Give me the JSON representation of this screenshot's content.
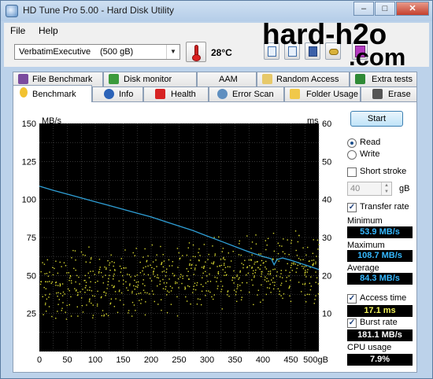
{
  "window": {
    "title": "HD Tune Pro 5.00 - Hard Disk Utility"
  },
  "menu": {
    "file": "File",
    "help": "Help"
  },
  "toolbar": {
    "drive_name": "VerbatimExecutive",
    "drive_size": "(500 gB)",
    "temperature": "28°C"
  },
  "brand": {
    "line1": "hard-h2o",
    "line2": ".com"
  },
  "tabs_row1": [
    "File Benchmark",
    "Disk monitor",
    "AAM",
    "Random Access",
    "Extra tests"
  ],
  "tabs_row2": [
    "Benchmark",
    "Info",
    "Health",
    "Error Scan",
    "Folder Usage",
    "Erase"
  ],
  "active_tab": "Benchmark",
  "controls": {
    "start_label": "Start",
    "read_label": "Read",
    "write_label": "Write",
    "mode_selected": "Read",
    "short_stroke_label": "Short stroke",
    "short_stroke_checked": false,
    "short_stroke_value": "40",
    "short_stroke_unit": "gB",
    "transfer_rate_label": "Transfer rate",
    "transfer_rate_checked": true,
    "minimum_label": "Minimum",
    "minimum_value": "53.9 MB/s",
    "maximum_label": "Maximum",
    "maximum_value": "108.7 MB/s",
    "average_label": "Average",
    "average_value": "84.3 MB/s",
    "access_time_label": "Access time",
    "access_time_checked": true,
    "access_time_value": "17.1 ms",
    "burst_rate_label": "Burst rate",
    "burst_rate_checked": true,
    "burst_rate_value": "181.1 MB/s",
    "cpu_usage_label": "CPU usage",
    "cpu_usage_value": "7.9%"
  },
  "colors": {
    "chart_bg": "#000000",
    "grid": "#555555",
    "transfer_line": "#2f9fd6",
    "access_dots": "#d8d830",
    "close_button": "#c4402e"
  },
  "chart_data": {
    "type": "line",
    "xlabel": "",
    "x_tick_labels": [
      "0",
      "50",
      "100",
      "150",
      "200",
      "250",
      "300",
      "350",
      "400",
      "450",
      "500gB"
    ],
    "y_left_unit": "MB/s",
    "y_left_ticks": [
      "150",
      "125",
      "100",
      "75",
      "50",
      "25"
    ],
    "y_right_unit": "ms",
    "y_right_ticks": [
      "60",
      "50",
      "40",
      "30",
      "20",
      "10"
    ],
    "xlim": [
      0,
      500
    ],
    "ylim_left": [
      0,
      150
    ],
    "ylim_right": [
      0,
      60
    ],
    "grid": true,
    "series": [
      {
        "name": "Transfer rate",
        "axis": "left",
        "x": [
          0,
          25,
          50,
          75,
          100,
          125,
          150,
          175,
          200,
          225,
          250,
          275,
          300,
          325,
          350,
          375,
          400,
          415,
          420,
          425,
          435,
          450,
          475,
          500
        ],
        "y": [
          108.7,
          106,
          103.5,
          101,
          98.5,
          96,
          93.5,
          91,
          88.5,
          85.5,
          82.5,
          79.5,
          76,
          72.5,
          69,
          65.5,
          62.5,
          61,
          57,
          60.5,
          61.5,
          60,
          57,
          53.9
        ]
      },
      {
        "name": "Access time",
        "axis": "right",
        "type": "scatter",
        "x_range": [
          0,
          500
        ],
        "y_spread": [
          6,
          32
        ],
        "mean": 17.1
      }
    ]
  }
}
